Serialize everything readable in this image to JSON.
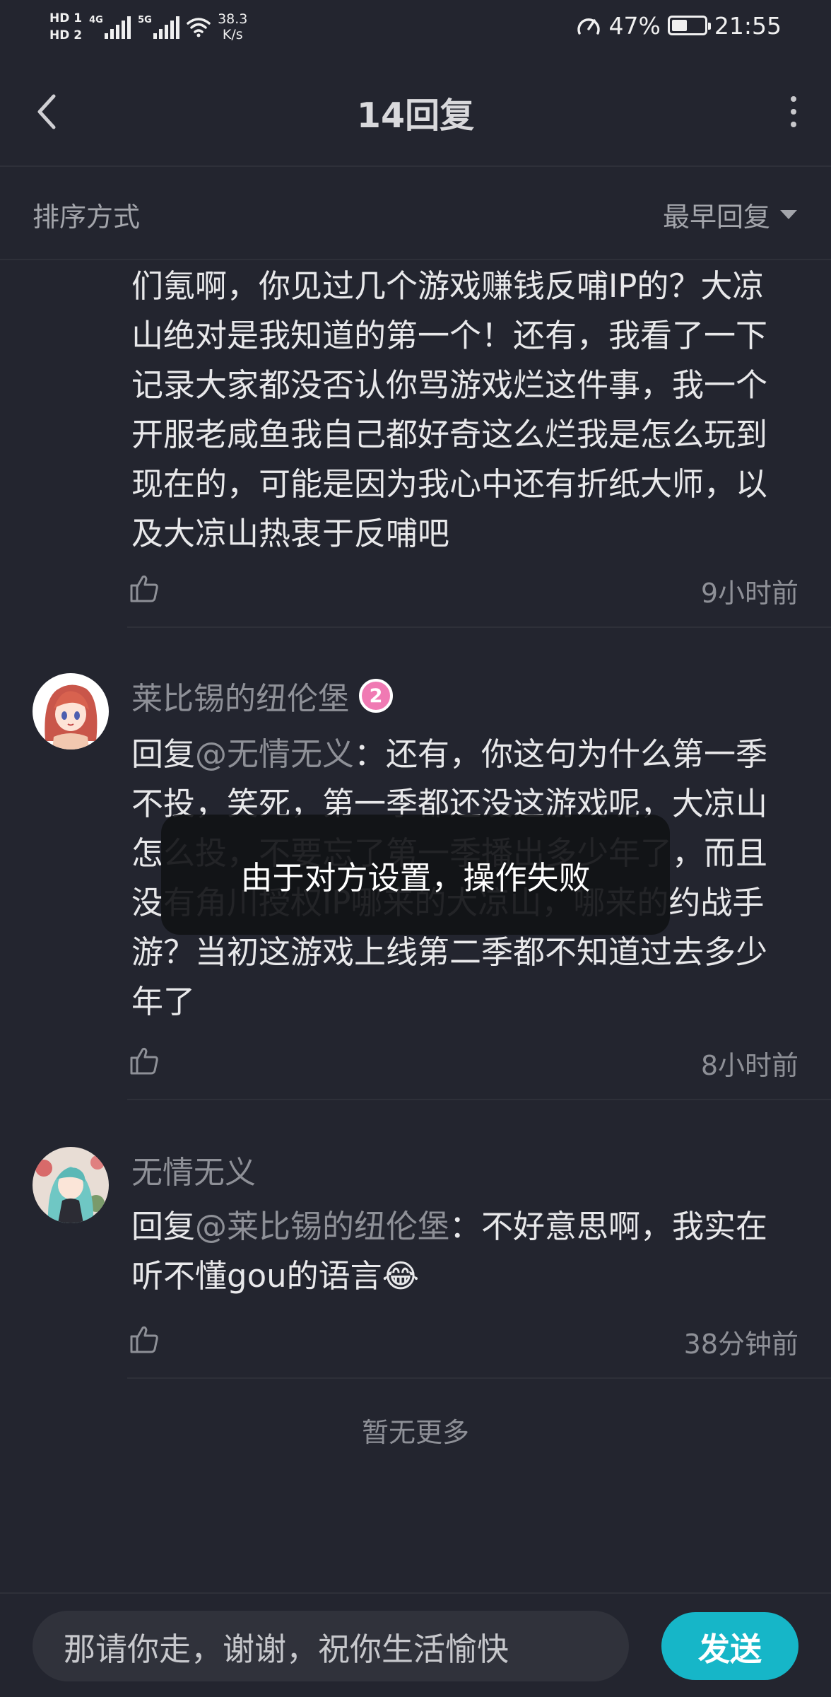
{
  "status_bar": {
    "sim1": "HD 1",
    "sim2": "HD 2",
    "net1": "4G",
    "net2": "5G",
    "speed_value": "38.3",
    "speed_unit": "K/s",
    "battery": "47%",
    "battery_level": 0.47,
    "time": "21:55"
  },
  "header": {
    "title": "14回复"
  },
  "sort": {
    "label": "排序方式",
    "selected": "最早回复"
  },
  "replies": [
    {
      "text": "们氪啊，你见过几个游戏赚钱反哺IP的？大凉山绝对是我知道的第一个！还有，我看了一下记录大家都没否认你骂游戏烂这件事，我一个开服老咸鱼我自己都好奇这么烂我是怎么玩到现在的，可能是因为我心中还有折纸大师，以及大凉山热衷于反哺吧",
      "time": "9小时前"
    },
    {
      "author": "莱比锡的纽伦堡",
      "level": "2",
      "prefix": "回复",
      "mention": "@无情无义",
      "text": "：还有，你这句为什么第一季不投，笑死，第一季都还没这游戏呢，大凉山怎么投，不要忘了第一季播出多少年了，而且没有角川授权IP哪来的大凉山，哪来的约战手游？当初这游戏上线第二季都不知道过去多少年了",
      "time": "8小时前"
    },
    {
      "author": "无情无义",
      "prefix": "回复",
      "mention": "@莱比锡的纽伦堡",
      "text": "：不好意思啊，我实在听不懂gou的语言",
      "emoji": "😂",
      "time": "38分钟前"
    }
  ],
  "footer": {
    "no_more": "暂无更多"
  },
  "toast": {
    "message": "由于对方设置，操作失败"
  },
  "composer": {
    "value": "那请你走，谢谢，祝你生活愉快",
    "send_label": "发送"
  },
  "colors": {
    "background": "#23252f",
    "accent": "#16b6c8",
    "level_badge": "#f07ab3"
  }
}
